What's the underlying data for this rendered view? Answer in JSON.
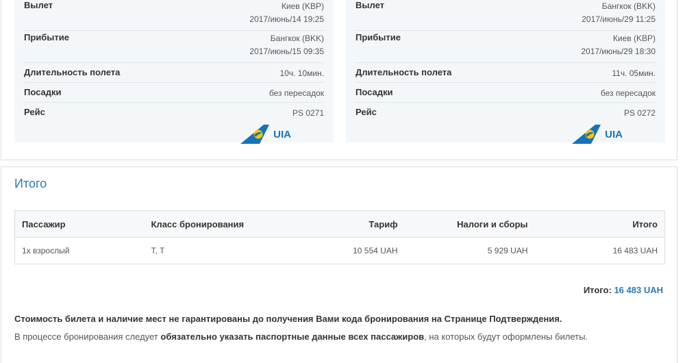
{
  "flights": [
    {
      "departure_label": "Вылет",
      "departure_city": "Киев (KBP)",
      "departure_time": "2017/июнь/14 19:25",
      "arrival_label": "Прибытие",
      "arrival_city": "Бангкок (BKK)",
      "arrival_time": "2017/июнь/15 09:35",
      "duration_label": "Длительность полета",
      "duration": "10ч. 10мин.",
      "stops_label": "Посадки",
      "stops": "без пересадок",
      "flight_label": "Рейс",
      "flight_number": "PS 0271",
      "airline_logo_text": "UIA"
    },
    {
      "departure_label": "Вылет",
      "departure_city": "Бангкок (BKK)",
      "departure_time": "2017/июнь/29 11:25",
      "arrival_label": "Прибытие",
      "arrival_city": "Киев (KBP)",
      "arrival_time": "2017/июнь/29 18:30",
      "duration_label": "Длительность полета",
      "duration": "11ч. 05мин.",
      "stops_label": "Посадки",
      "stops": "без пересадок",
      "flight_label": "Рейс",
      "flight_number": "PS 0272",
      "airline_logo_text": "UIA"
    }
  ],
  "summary": {
    "title": "Итого",
    "columns": [
      "Пассажир",
      "Класс бронирования",
      "Тариф",
      "Налоги и сборы",
      "Итого"
    ],
    "rows": [
      {
        "passenger": "1x взрослый",
        "class": "T, T",
        "fare": "10 554 UAH",
        "taxes": "5 929 UAH",
        "total": "16 483 UAH"
      }
    ],
    "grand_total_label": "Итого:",
    "grand_total_value": "16 483 UAH"
  },
  "notices": {
    "line1": "Стоимость билета и наличие мест не гарантированы до получения Вами кода бронирования на Странице Подтверждения.",
    "line2_pre": "В процессе бронирования следует ",
    "line2_bold": "обязательно указать паспортные данные всех пассажиров",
    "line2_post": ", на которых будут оформлены билеты."
  },
  "colors": {
    "accent": "#2b7ab8",
    "card_bg": "#f3f7fa",
    "logo_blue": "#1673ba",
    "logo_yellow": "#f7c600"
  },
  "icons": {
    "airline_logo": "uia-tail-logo"
  }
}
